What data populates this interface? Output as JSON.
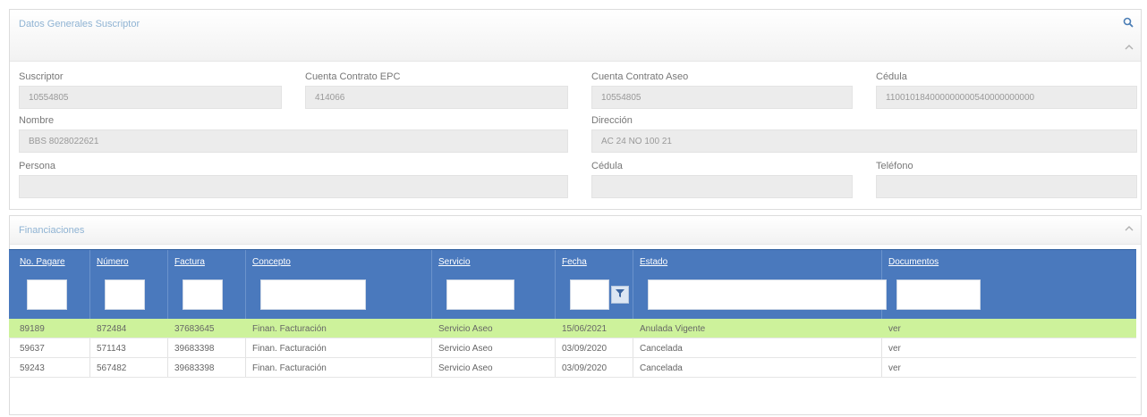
{
  "subscriber_panel": {
    "title": "Datos Generales Suscriptor",
    "fields": {
      "suscriptor": {
        "label": "Suscriptor",
        "value": "10554805"
      },
      "cuenta_contrato_epc": {
        "label": "Cuenta Contrato EPC",
        "value": "414066"
      },
      "cuenta_contrato_aseo": {
        "label": "Cuenta Contrato Aseo",
        "value": "10554805"
      },
      "cedula_catastral": {
        "label": "Cédula",
        "value": "110010184000000000540000000000"
      },
      "nombre": {
        "label": "Nombre",
        "value": "BBS 8028022621"
      },
      "direccion": {
        "label": "Dirección",
        "value": "AC 24 NO 100 21"
      },
      "persona": {
        "label": "Persona",
        "value": ""
      },
      "cedula": {
        "label": "Cédula",
        "value": ""
      },
      "telefono": {
        "label": "Teléfono",
        "value": ""
      }
    }
  },
  "financing_panel": {
    "title": "Financiaciones",
    "columns": [
      "No. Pagare",
      "Número",
      "Factura",
      "Concepto",
      "Servicio",
      "Fecha",
      "Estado",
      "Documentos"
    ],
    "rows": [
      {
        "pagare": "89189",
        "numero": "872484",
        "factura": "37683645",
        "concepto": "Finan. Facturación",
        "servicio": "Servicio Aseo",
        "fecha": "15/06/2021",
        "estado": "Anulada Vigente",
        "documentos": "ver",
        "selected": true
      },
      {
        "pagare": "59637",
        "numero": "571143",
        "factura": "39683398",
        "concepto": "Finan. Facturación",
        "servicio": "Servicio Aseo",
        "fecha": "03/09/2020",
        "estado": "Cancelada",
        "documentos": "ver",
        "selected": false
      },
      {
        "pagare": "59243",
        "numero": "567482",
        "factura": "39683398",
        "concepto": "Finan. Facturación",
        "servicio": "Servicio Aseo",
        "fecha": "03/09/2020",
        "estado": "Cancelada",
        "documentos": "ver",
        "selected": false
      }
    ]
  },
  "icons": {
    "search": "search-icon",
    "collapse": "chevron-up-icon",
    "filter": "filter-icon"
  },
  "colors": {
    "grid_header": "#4a79bd",
    "selected_row": "#cdf29b",
    "panel_title": "#8fb3d3"
  }
}
